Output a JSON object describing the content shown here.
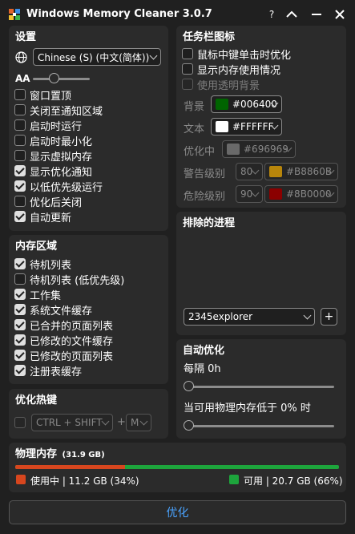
{
  "titlebar": {
    "title": "Windows Memory Cleaner 3.0.7",
    "help_label": "?"
  },
  "settings": {
    "title": "设置",
    "language": "Chinese (S) (中文(简体))",
    "font_size_label": "AA",
    "options": [
      {
        "label": "窗口置顶",
        "checked": false
      },
      {
        "label": "关闭至通知区域",
        "checked": false
      },
      {
        "label": "启动时运行",
        "checked": false
      },
      {
        "label": "启动时最小化",
        "checked": false
      },
      {
        "label": "显示虚拟内存",
        "checked": false
      },
      {
        "label": "显示优化通知",
        "checked": true
      },
      {
        "label": "以低优先级运行",
        "checked": true
      },
      {
        "label": "优化后关闭",
        "checked": false
      },
      {
        "label": "自动更新",
        "checked": true
      }
    ]
  },
  "taskbar": {
    "title": "任务栏图标",
    "options": [
      {
        "label": "鼠标中键单击时优化",
        "checked": false,
        "disabled": false
      },
      {
        "label": "显示内存使用情况",
        "checked": false,
        "disabled": false
      },
      {
        "label": "使用透明背景",
        "checked": false,
        "disabled": true
      }
    ],
    "background_label": "背景",
    "background_color": "#006400",
    "text_label": "文本",
    "text_color": "#FFFFFF",
    "optimizing_label": "优化中",
    "optimizing_color": "#696969",
    "warning_label": "警告级别",
    "warning_level": "80",
    "warning_color": "#B8860B",
    "danger_label": "危险级别",
    "danger_level": "90",
    "danger_color": "#8B0000"
  },
  "memory_areas": {
    "title": "内存区域",
    "options": [
      {
        "label": "待机列表",
        "checked": true
      },
      {
        "label": "待机列表 (低优先级)",
        "checked": false
      },
      {
        "label": "工作集",
        "checked": true
      },
      {
        "label": "系统文件缓存",
        "checked": true
      },
      {
        "label": "已合并的页面列表",
        "checked": true
      },
      {
        "label": "已修改的文件缓存",
        "checked": true
      },
      {
        "label": "已修改的页面列表",
        "checked": true
      },
      {
        "label": "注册表缓存",
        "checked": true
      }
    ]
  },
  "excluded": {
    "title": "排除的进程",
    "process": "2345explorer",
    "add_label": "+"
  },
  "auto_optimize": {
    "title": "自动优化",
    "interval_label": "每隔 0h",
    "interval_value": 0,
    "threshold_label": "当可用物理内存低于 0% 时",
    "threshold_value": 0
  },
  "hotkey": {
    "title": "优化热键",
    "modifiers": "CTRL + SHIFT",
    "plus": "+",
    "key": "M"
  },
  "physical_memory": {
    "title": "物理内存",
    "total": "(31.9 GB)",
    "used_label": "使用中 | 11.2 GB (34%)",
    "used_fraction": 0.34,
    "free_label": "可用 | 20.7 GB (66%)",
    "used_color": "#D7461E",
    "free_color": "#1DA53C"
  },
  "optimize_button": "优化"
}
